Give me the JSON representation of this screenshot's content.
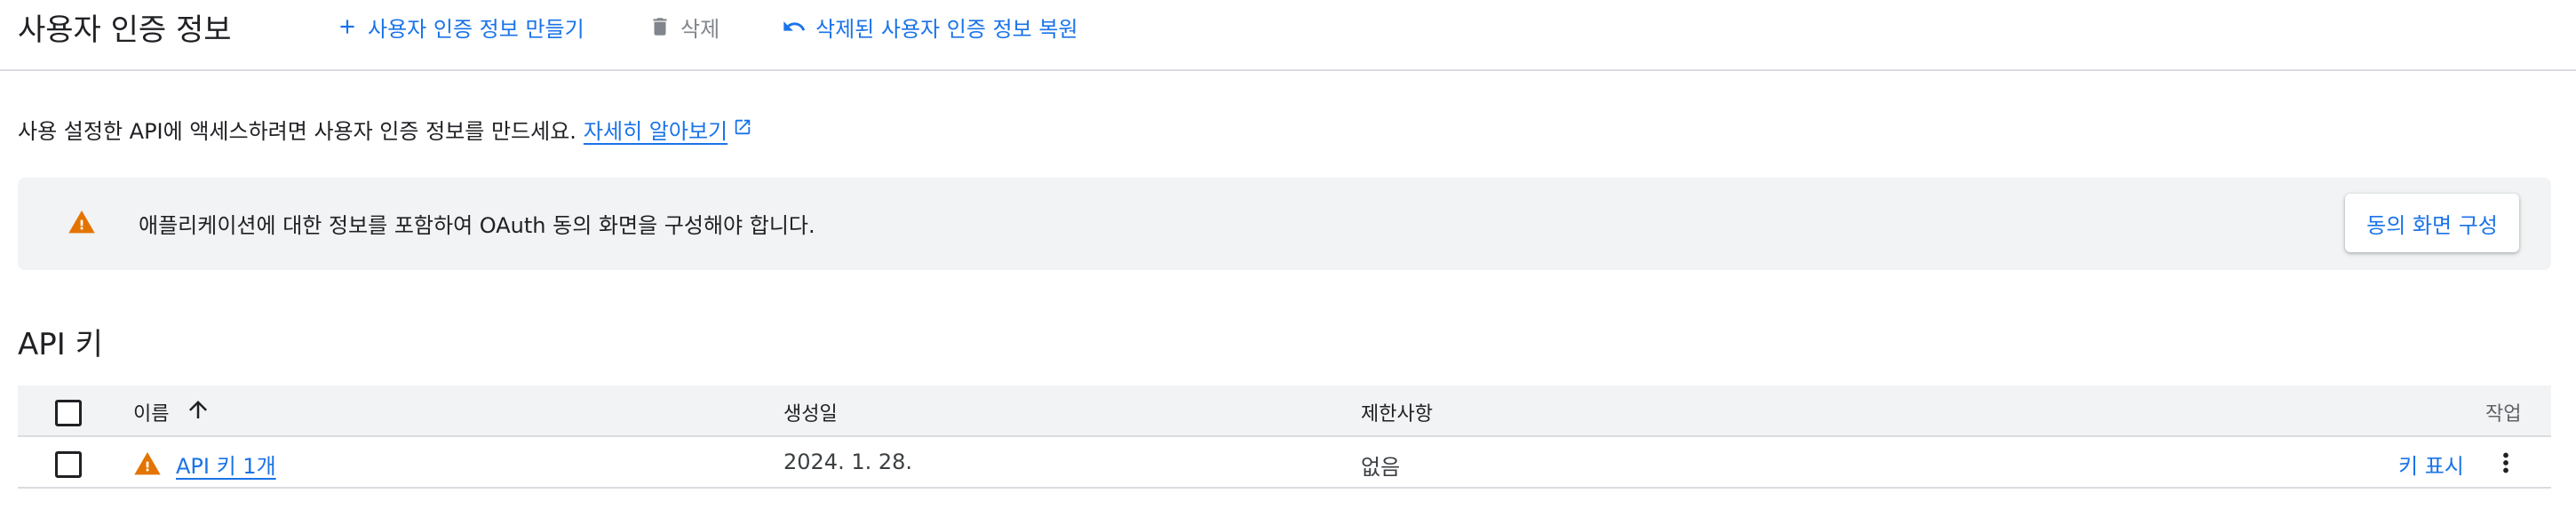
{
  "header": {
    "title": "사용자 인증 정보",
    "create_label": "사용자 인증 정보 만들기",
    "delete_label": "삭제",
    "restore_label": "삭제된 사용자 인증 정보 복원"
  },
  "info": {
    "text": "사용 설정한 API에 액세스하려면 사용자 인증 정보를 만드세요.",
    "learn_more": "자세히 알아보기"
  },
  "banner": {
    "text": "애플리케이션에 대한 정보를 포함하여 OAuth 동의 화면을 구성해야 합니다.",
    "button": "동의 화면 구성"
  },
  "api_keys": {
    "title": "API 키",
    "columns": {
      "name": "이름",
      "created": "생성일",
      "restrictions": "제한사항",
      "actions": "작업"
    },
    "rows": [
      {
        "name": "API 키 1개",
        "created": "2024. 1. 28.",
        "restrictions": "없음",
        "show_key": "키 표시"
      }
    ]
  },
  "colors": {
    "accent": "#1a73e8",
    "warning": "#e37400",
    "banner_bg": "#f1f3f4",
    "disabled": "#80868b"
  },
  "icons": [
    "add-icon",
    "trash-icon",
    "undo-icon",
    "external-link-icon",
    "warning-icon",
    "arrow-up-icon",
    "more-vert-icon"
  ]
}
